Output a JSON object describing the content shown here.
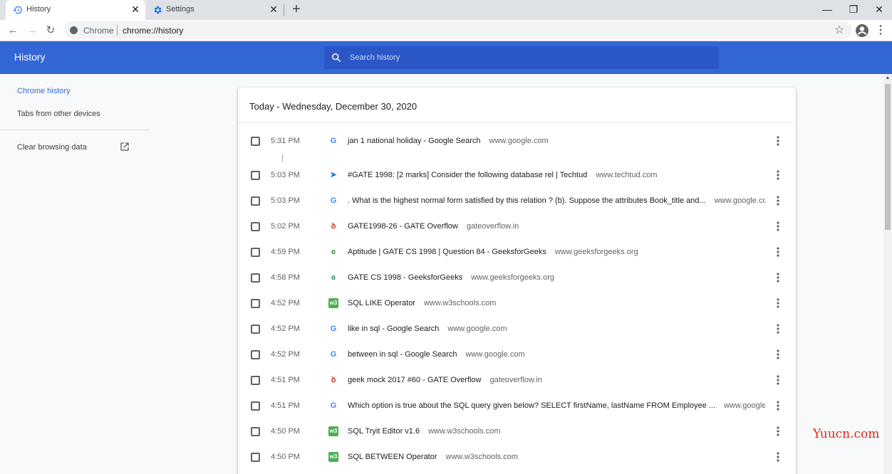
{
  "tabs": [
    {
      "title": "History",
      "icon": "history-icon"
    },
    {
      "title": "Settings",
      "icon": "settings-gear-icon"
    }
  ],
  "tab_close_glyph": "✕",
  "new_tab_glyph": "+",
  "window_controls": {
    "minimize": "—",
    "maximize": "❐",
    "close": "✕"
  },
  "toolbar": {
    "back_glyph": "←",
    "forward_glyph": "→",
    "reload_glyph": "↻",
    "site_label": "Chrome",
    "url": "chrome://history",
    "bookmark_glyph": "☆",
    "menu_glyph": "⋮"
  },
  "header": {
    "title": "History",
    "search_placeholder": "Search history"
  },
  "sidebar": {
    "items": [
      {
        "label": "Chrome history",
        "active": true
      },
      {
        "label": "Tabs from other devices",
        "active": false
      }
    ],
    "clear_label": "Clear browsing data"
  },
  "day_heading": "Today - Wednesday, December 30, 2020",
  "entries": [
    {
      "time": "5:31 PM",
      "title": "jan 1 national holiday - Google Search",
      "domain": "www.google.com",
      "icon": "google-g-icon"
    },
    {
      "time": "5:03 PM",
      "title": "#GATE 1998: [2 marks] Consider the following database rel | Techtud",
      "domain": "www.techtud.com",
      "icon": "techtud-icon"
    },
    {
      "time": "5:03 PM",
      "title": ". What is the highest normal form satisfied by this relation ? (b). Suppose the attributes Book_title and...",
      "domain": "www.google.com",
      "icon": "google-g-icon"
    },
    {
      "time": "5:02 PM",
      "title": "GATE1998-26 - GATE Overflow",
      "domain": "gateoverflow.in",
      "icon": "gateoverflow-icon"
    },
    {
      "time": "4:59 PM",
      "title": "Aptitude | GATE CS 1998 | Question 84 - GeeksforGeeks",
      "domain": "www.geeksforgeeks.org",
      "icon": "geeksforgeeks-icon"
    },
    {
      "time": "4:58 PM",
      "title": "GATE CS 1998 - GeeksforGeeks",
      "domain": "www.geeksforgeeks.org",
      "icon": "geeksforgeeks-icon"
    },
    {
      "time": "4:52 PM",
      "title": "SQL LIKE Operator",
      "domain": "www.w3schools.com",
      "icon": "w3schools-icon"
    },
    {
      "time": "4:52 PM",
      "title": "like in sql - Google Search",
      "domain": "www.google.com",
      "icon": "google-g-icon"
    },
    {
      "time": "4:52 PM",
      "title": "between in sql - Google Search",
      "domain": "www.google.com",
      "icon": "google-g-icon"
    },
    {
      "time": "4:51 PM",
      "title": "geek mock 2017 #60 - GATE Overflow",
      "domain": "gateoverflow.in",
      "icon": "gateoverflow-icon"
    },
    {
      "time": "4:51 PM",
      "title": "Which option is true about the SQL query given below? SELECT firstName, lastName FROM Employee ...",
      "domain": "www.google.com",
      "icon": "google-g-icon"
    },
    {
      "time": "4:50 PM",
      "title": "SQL Tryit Editor v1.6",
      "domain": "www.w3schools.com",
      "icon": "w3schools-icon"
    },
    {
      "time": "4:50 PM",
      "title": "SQL BETWEEN Operator",
      "domain": "www.w3schools.com",
      "icon": "w3schools-icon"
    }
  ],
  "icon_glyphs": {
    "google-g-icon": "G",
    "techtud-icon": "➤",
    "gateoverflow-icon": "ꝺ",
    "geeksforgeeks-icon": "ɞ",
    "w3schools-icon": "w3"
  },
  "colors": {
    "header_blue": "#3367d6",
    "search_blue": "#2a56c6",
    "google": "#4285f4",
    "techtud": "#1a73e8",
    "gateoverflow": "#d93025",
    "geeksforgeeks": "#2f8d46",
    "w3schools": "#4caf50"
  },
  "watermark": "Yuucn.com"
}
